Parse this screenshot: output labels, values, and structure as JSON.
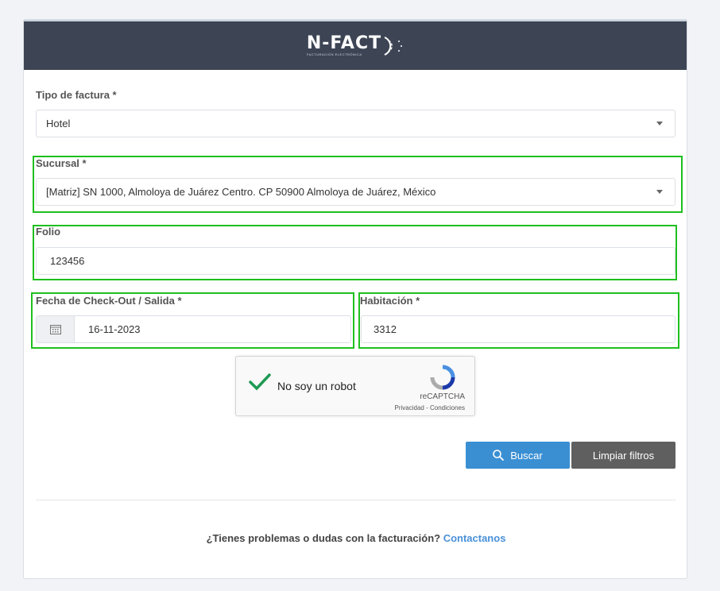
{
  "header": {
    "logo_text": "N-FACT",
    "logo_subtext": "FACTURACIÓN ELECTRÓNICA"
  },
  "form": {
    "tipo_factura": {
      "label": "Tipo de factura *",
      "value": "Hotel"
    },
    "sucursal": {
      "label": "Sucursal *",
      "value": "[Matriz] SN 1000, Almoloya de Juárez Centro. CP 50900 Almoloya de Juárez, México"
    },
    "folio": {
      "label": "Folio",
      "value": "123456"
    },
    "fecha": {
      "label": "Fecha de Check-Out / Salida *",
      "value": "16-11-2023"
    },
    "habitacion": {
      "label": "Habitación *",
      "value": "3312"
    }
  },
  "captcha": {
    "label": "No soy un robot",
    "brand": "reCAPTCHA",
    "privacy": "Privacidad",
    "terms": "Condiciones",
    "separator": " - "
  },
  "buttons": {
    "search": "Buscar",
    "clear": "Limpiar filtros"
  },
  "footer": {
    "question": "¿Tienes problemas o dudas con la facturación? ",
    "contact": "Contactanos"
  },
  "colors": {
    "header_bg": "#3d4555",
    "highlight": "#1fbf1f",
    "primary": "#3a8fd3",
    "secondary": "#5f5f5f"
  }
}
